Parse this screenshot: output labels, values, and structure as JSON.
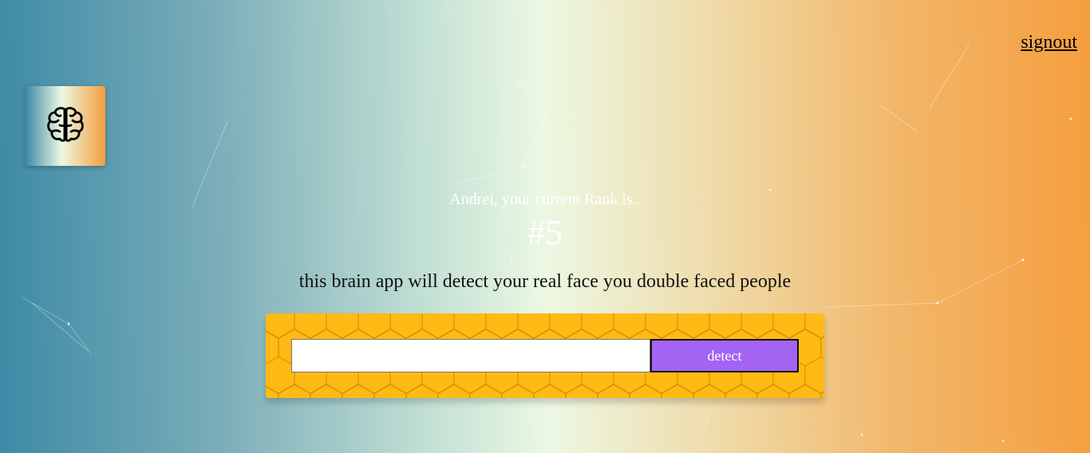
{
  "nav": {
    "signout_label": "signout"
  },
  "logo": {
    "icon": "brain-icon"
  },
  "rank": {
    "intro": "Andrei, your current Rank is..",
    "value": "#5"
  },
  "tagline": "this brain app will detect your real face you double faced people",
  "form": {
    "input_value": "",
    "input_placeholder": "",
    "button_label": "detect"
  },
  "colors": {
    "gradient_start": "#3d8aa6",
    "gradient_mid": "#ecf8e3",
    "gradient_end": "#f59e3e",
    "form_bg": "#ffbb14",
    "button_bg": "#a463f2"
  }
}
